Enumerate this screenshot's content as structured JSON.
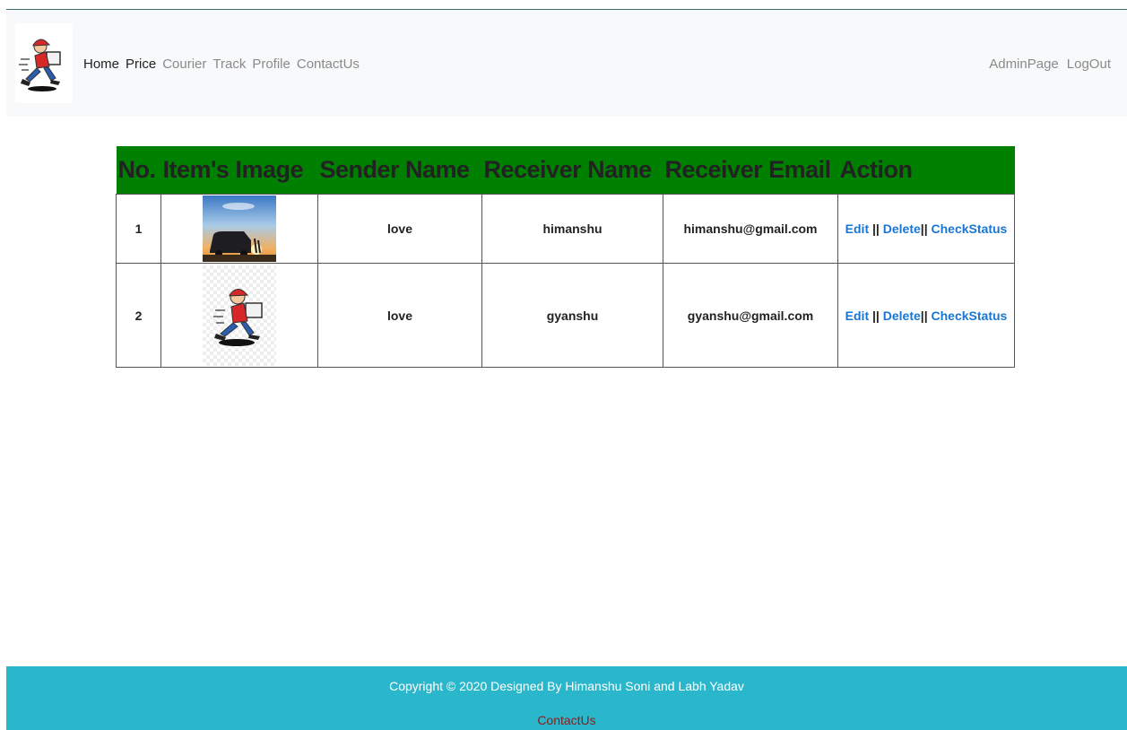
{
  "nav": {
    "left": [
      "Home",
      "Price",
      "Courier",
      "Track",
      "Profile",
      "ContactUs"
    ],
    "right": [
      "AdminPage",
      "LogOut"
    ]
  },
  "table": {
    "headers": [
      "No.",
      "Item's Image",
      "Sender Name",
      "Receiver Name",
      "Receiver Email",
      "Action"
    ],
    "rows": [
      {
        "no": "1",
        "image": "van-sunset-image",
        "sender": "love",
        "receiver": "himanshu",
        "email": "himanshu@gmail.com"
      },
      {
        "no": "2",
        "image": "courier-mascot-image",
        "sender": "love",
        "receiver": "gyanshu",
        "email": "gyanshu@gmail.com"
      }
    ],
    "actions": {
      "edit": "Edit",
      "delete": "Delete",
      "check": "CheckStatus",
      "sep": "||"
    }
  },
  "footer": {
    "copyright": "Copyright © 2020 Designed By Himanshu Soni and Labh Yadav",
    "link": "ContactUs"
  },
  "colors": {
    "header_bg": "#008000",
    "footer_bg": "#2bb7cb",
    "link": "#1976d2"
  }
}
